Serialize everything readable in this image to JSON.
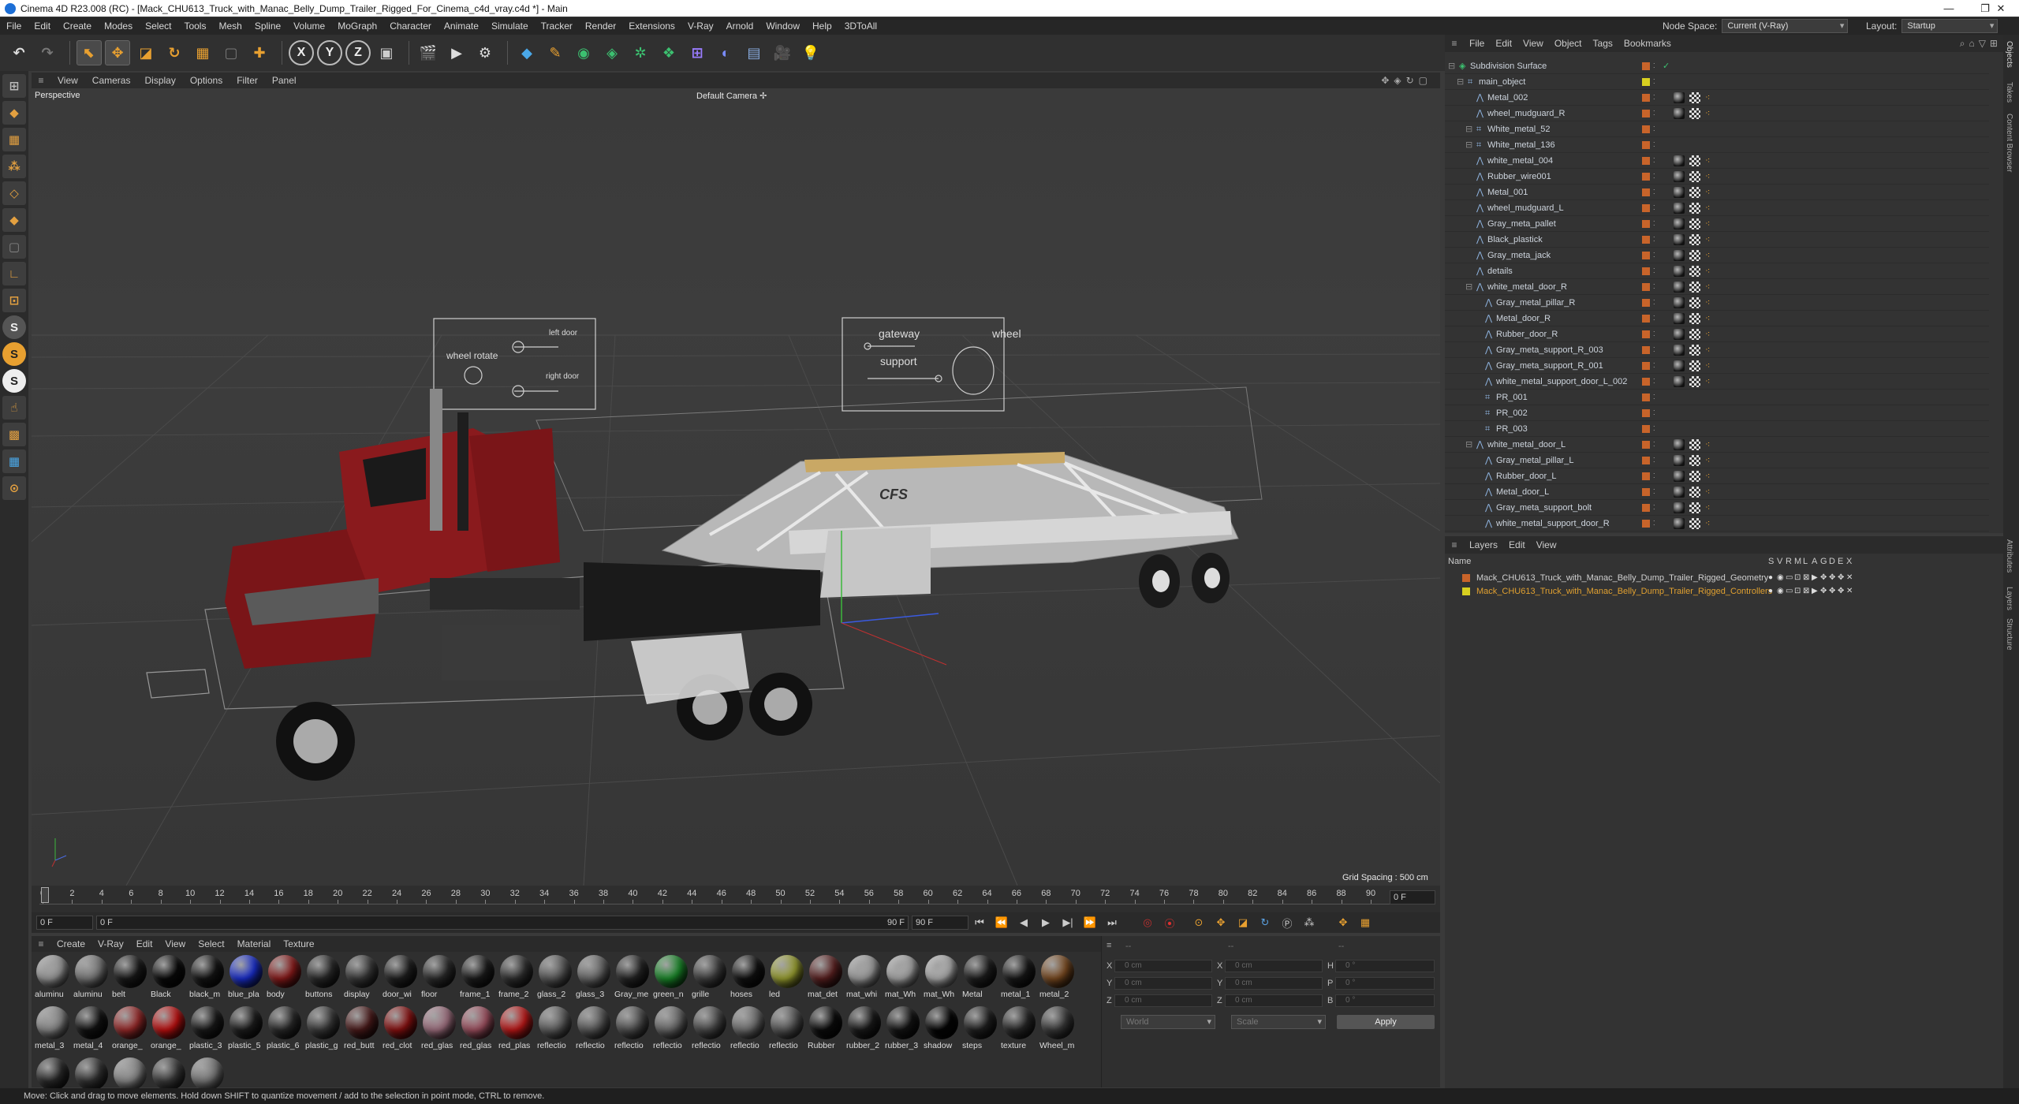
{
  "window": {
    "title": "Cinema 4D R23.008 (RC) - [Mack_CHU613_Truck_with_Manac_Belly_Dump_Trailer_Rigged_For_Cinema_c4d_vray.c4d *] - Main",
    "minimize": "—",
    "maximize": "❐",
    "close": "✕"
  },
  "menubar": {
    "items": [
      "File",
      "Edit",
      "Create",
      "Modes",
      "Select",
      "Tools",
      "Mesh",
      "Spline",
      "Volume",
      "MoGraph",
      "Character",
      "Animate",
      "Simulate",
      "Tracker",
      "Render",
      "Extensions",
      "V-Ray",
      "Arnold",
      "Window",
      "Help",
      "3DToAll"
    ],
    "node_space_label": "Node Space:",
    "node_space_value": "Current (V-Ray)",
    "layout_label": "Layout:",
    "layout_value": "Startup"
  },
  "viewport": {
    "menu": [
      "View",
      "Cameras",
      "Display",
      "Options",
      "Filter",
      "Panel"
    ],
    "label": "Perspective",
    "camera": "Default Camera",
    "grid_spacing": "Grid Spacing : 500 cm",
    "hud_left": {
      "left_door": "left door",
      "wheel_rotate": "wheel rotate",
      "right_door": "right door"
    },
    "hud_right": {
      "gateway": "gateway",
      "support": "support",
      "wheel": "wheel"
    },
    "trailer_logo": "CFS"
  },
  "timeline": {
    "ticks": [
      "0",
      "2",
      "4",
      "6",
      "8",
      "10",
      "12",
      "14",
      "16",
      "18",
      "20",
      "22",
      "24",
      "26",
      "28",
      "30",
      "32",
      "34",
      "36",
      "38",
      "40",
      "42",
      "44",
      "46",
      "48",
      "50",
      "52",
      "54",
      "56",
      "58",
      "60",
      "62",
      "64",
      "66",
      "68",
      "70",
      "72",
      "74",
      "76",
      "78",
      "80",
      "82",
      "84",
      "86",
      "88",
      "90"
    ],
    "current_frame": "0 F",
    "start_field": "0 F",
    "range_start": "0 F",
    "range_end": "90 F",
    "end_field": "90 F"
  },
  "materials": {
    "menu": [
      "Create",
      "V-Ray",
      "Edit",
      "View",
      "Select",
      "Material",
      "Texture"
    ],
    "items": [
      {
        "label": "aluminu",
        "color": "#9a9a9a"
      },
      {
        "label": "aluminu",
        "color": "#7a7a7a"
      },
      {
        "label": "belt",
        "color": "#1a1a1a"
      },
      {
        "label": "Black",
        "color": "#0a0a0a"
      },
      {
        "label": "black_m",
        "color": "#151515"
      },
      {
        "label": "blue_pla",
        "color": "#1a2fd0"
      },
      {
        "label": "body",
        "color": "#8a1a1a"
      },
      {
        "label": "buttons",
        "color": "#2a2a2a"
      },
      {
        "label": "display",
        "color": "#3a3a3a"
      },
      {
        "label": "door_wi",
        "color": "#202020"
      },
      {
        "label": "floor",
        "color": "#2c2c2c"
      },
      {
        "label": "frame_1",
        "color": "#1c1c1c"
      },
      {
        "label": "frame_2",
        "color": "#303030"
      },
      {
        "label": "glass_2",
        "color": "#5a5a5a"
      },
      {
        "label": "glass_3",
        "color": "#6a6a6a"
      },
      {
        "label": "Gray_me",
        "color": "#252525"
      },
      {
        "label": "green_n",
        "color": "#1a8a2a"
      },
      {
        "label": "grille",
        "color": "#404040"
      },
      {
        "label": "hoses",
        "color": "#111111"
      },
      {
        "label": "led",
        "color": "#9aa030"
      },
      {
        "label": "mat_det",
        "color": "#5a2020"
      },
      {
        "label": "mat_whi",
        "color": "#a0a0a0"
      },
      {
        "label": "mat_Wh",
        "color": "#a8a8a8"
      },
      {
        "label": "mat_Wh",
        "color": "#b0b0b0"
      },
      {
        "label": "Metal",
        "color": "#1e1e1e"
      },
      {
        "label": "metal_1",
        "color": "#181818"
      },
      {
        "label": "metal_2",
        "color": "#7a4a20"
      },
      {
        "label": "metal_3",
        "color": "#8a8a8a"
      },
      {
        "label": "metal_4",
        "color": "#121212"
      },
      {
        "label": "orange_",
        "color": "#9a2a2a"
      },
      {
        "label": "orange_",
        "color": "#c01010"
      },
      {
        "label": "plastic_3",
        "color": "#1a1a1a"
      },
      {
        "label": "plastic_5",
        "color": "#1e1e1e"
      },
      {
        "label": "plastic_6",
        "color": "#2a2a2a"
      },
      {
        "label": "plastic_g",
        "color": "#3a3a3a"
      },
      {
        "label": "red_butt",
        "color": "#4a1a1a"
      },
      {
        "label": "red_clot",
        "color": "#8a1010"
      },
      {
        "label": "red_glas",
        "color": "#a07080"
      },
      {
        "label": "red_glas",
        "color": "#a05060"
      },
      {
        "label": "red_plas",
        "color": "#c01818"
      },
      {
        "label": "reflectio",
        "color": "#606060"
      },
      {
        "label": "reflectio",
        "color": "#5a5a5a"
      },
      {
        "label": "reflectio",
        "color": "#505050"
      },
      {
        "label": "reflectio",
        "color": "#6a6a6a"
      },
      {
        "label": "reflectio",
        "color": "#4a4a4a"
      },
      {
        "label": "reflectio",
        "color": "#707070"
      },
      {
        "label": "reflectio",
        "color": "#585858"
      },
      {
        "label": "Rubber",
        "color": "#0c0c0c"
      },
      {
        "label": "rubber_2",
        "color": "#1a1a1a"
      },
      {
        "label": "rubber_3",
        "color": "#141414"
      },
      {
        "label": "shadow",
        "color": "#050505"
      },
      {
        "label": "steps",
        "color": "#202020"
      },
      {
        "label": "texture",
        "color": "#282828"
      },
      {
        "label": "Wheel_m",
        "color": "#3a3a3a"
      },
      {
        "label": "",
        "color": "#2a2a2a"
      },
      {
        "label": "",
        "color": "#333333"
      },
      {
        "label": "",
        "color": "#8a8a8a"
      },
      {
        "label": "",
        "color": "#3c3c3c"
      },
      {
        "label": "",
        "color": "#7a7a7a"
      }
    ]
  },
  "coords": {
    "x": "X",
    "y": "Y",
    "z": "Z",
    "h": "H",
    "p": "P",
    "b": "B",
    "pos": "0 cm",
    "size": "0 cm",
    "rot": "0 °",
    "world": "World",
    "scale": "Scale",
    "apply": "Apply",
    "dash1": "--",
    "dash2": "--",
    "dash3": "--"
  },
  "objects": {
    "menu": [
      "File",
      "Edit",
      "View",
      "Object",
      "Tags",
      "Bookmarks"
    ],
    "rows": [
      {
        "name": "Subdivision Surface",
        "indent": 0,
        "kind": "subd"
      },
      {
        "name": "main_object",
        "indent": 1,
        "kind": "null"
      },
      {
        "name": "Metal_002",
        "indent": 2,
        "kind": "poly"
      },
      {
        "name": "wheel_mudguard_R",
        "indent": 2,
        "kind": "poly"
      },
      {
        "name": "White_metal_52",
        "indent": 2,
        "kind": "null"
      },
      {
        "name": "White_metal_136",
        "indent": 2,
        "kind": "null"
      },
      {
        "name": "white_metal_004",
        "indent": 2,
        "kind": "poly"
      },
      {
        "name": "Rubber_wire001",
        "indent": 2,
        "kind": "poly"
      },
      {
        "name": "Metal_001",
        "indent": 2,
        "kind": "poly"
      },
      {
        "name": "wheel_mudguard_L",
        "indent": 2,
        "kind": "poly"
      },
      {
        "name": "Gray_meta_pallet",
        "indent": 2,
        "kind": "poly"
      },
      {
        "name": "Black_plastick",
        "indent": 2,
        "kind": "poly"
      },
      {
        "name": "Gray_meta_jack",
        "indent": 2,
        "kind": "poly"
      },
      {
        "name": "details",
        "indent": 2,
        "kind": "poly"
      },
      {
        "name": "white_metal_door_R",
        "indent": 2,
        "kind": "poly"
      },
      {
        "name": "Gray_metal_pillar_R",
        "indent": 3,
        "kind": "poly"
      },
      {
        "name": "Metal_door_R",
        "indent": 3,
        "kind": "poly"
      },
      {
        "name": "Rubber_door_R",
        "indent": 3,
        "kind": "poly"
      },
      {
        "name": "Gray_meta_support_R_003",
        "indent": 3,
        "kind": "poly"
      },
      {
        "name": "Gray_meta_support_R_001",
        "indent": 3,
        "kind": "poly"
      },
      {
        "name": "white_metal_support_door_L_002",
        "indent": 3,
        "kind": "poly"
      },
      {
        "name": "PR_001",
        "indent": 3,
        "kind": "null"
      },
      {
        "name": "PR_002",
        "indent": 3,
        "kind": "null"
      },
      {
        "name": "PR_003",
        "indent": 3,
        "kind": "null"
      },
      {
        "name": "white_metal_door_L",
        "indent": 2,
        "kind": "poly"
      },
      {
        "name": "Gray_metal_pillar_L",
        "indent": 3,
        "kind": "poly"
      },
      {
        "name": "Rubber_door_L",
        "indent": 3,
        "kind": "poly"
      },
      {
        "name": "Metal_door_L",
        "indent": 3,
        "kind": "poly"
      },
      {
        "name": "Gray_meta_support_bolt",
        "indent": 3,
        "kind": "poly"
      },
      {
        "name": "white_metal_support_door_R",
        "indent": 3,
        "kind": "poly"
      }
    ]
  },
  "layers": {
    "tabs": [
      "Layers",
      "Edit",
      "View"
    ],
    "name_header": "Name",
    "flags": [
      "S",
      "V",
      "R",
      "M",
      "L",
      "A",
      "G",
      "D",
      "E",
      "X"
    ],
    "rows": [
      {
        "name": "Mack_CHU613_Truck_with_Manac_Belly_Dump_Trailer_Rigged_Geometry",
        "color": "#c8642a",
        "text_color": "#d0d0d0"
      },
      {
        "name": "Mack_CHU613_Truck_with_Manac_Belly_Dump_Trailer_Rigged_Controllers",
        "color": "#d8d020",
        "text_color": "#e0a030"
      }
    ]
  },
  "side_tabs": [
    "Objects",
    "Takes",
    "Content Browser",
    "Attributes",
    "Layers",
    "Structure"
  ],
  "status": "Move: Click and drag to move elements. Hold down SHIFT to quantize movement / add to the selection in point mode, CTRL to remove."
}
